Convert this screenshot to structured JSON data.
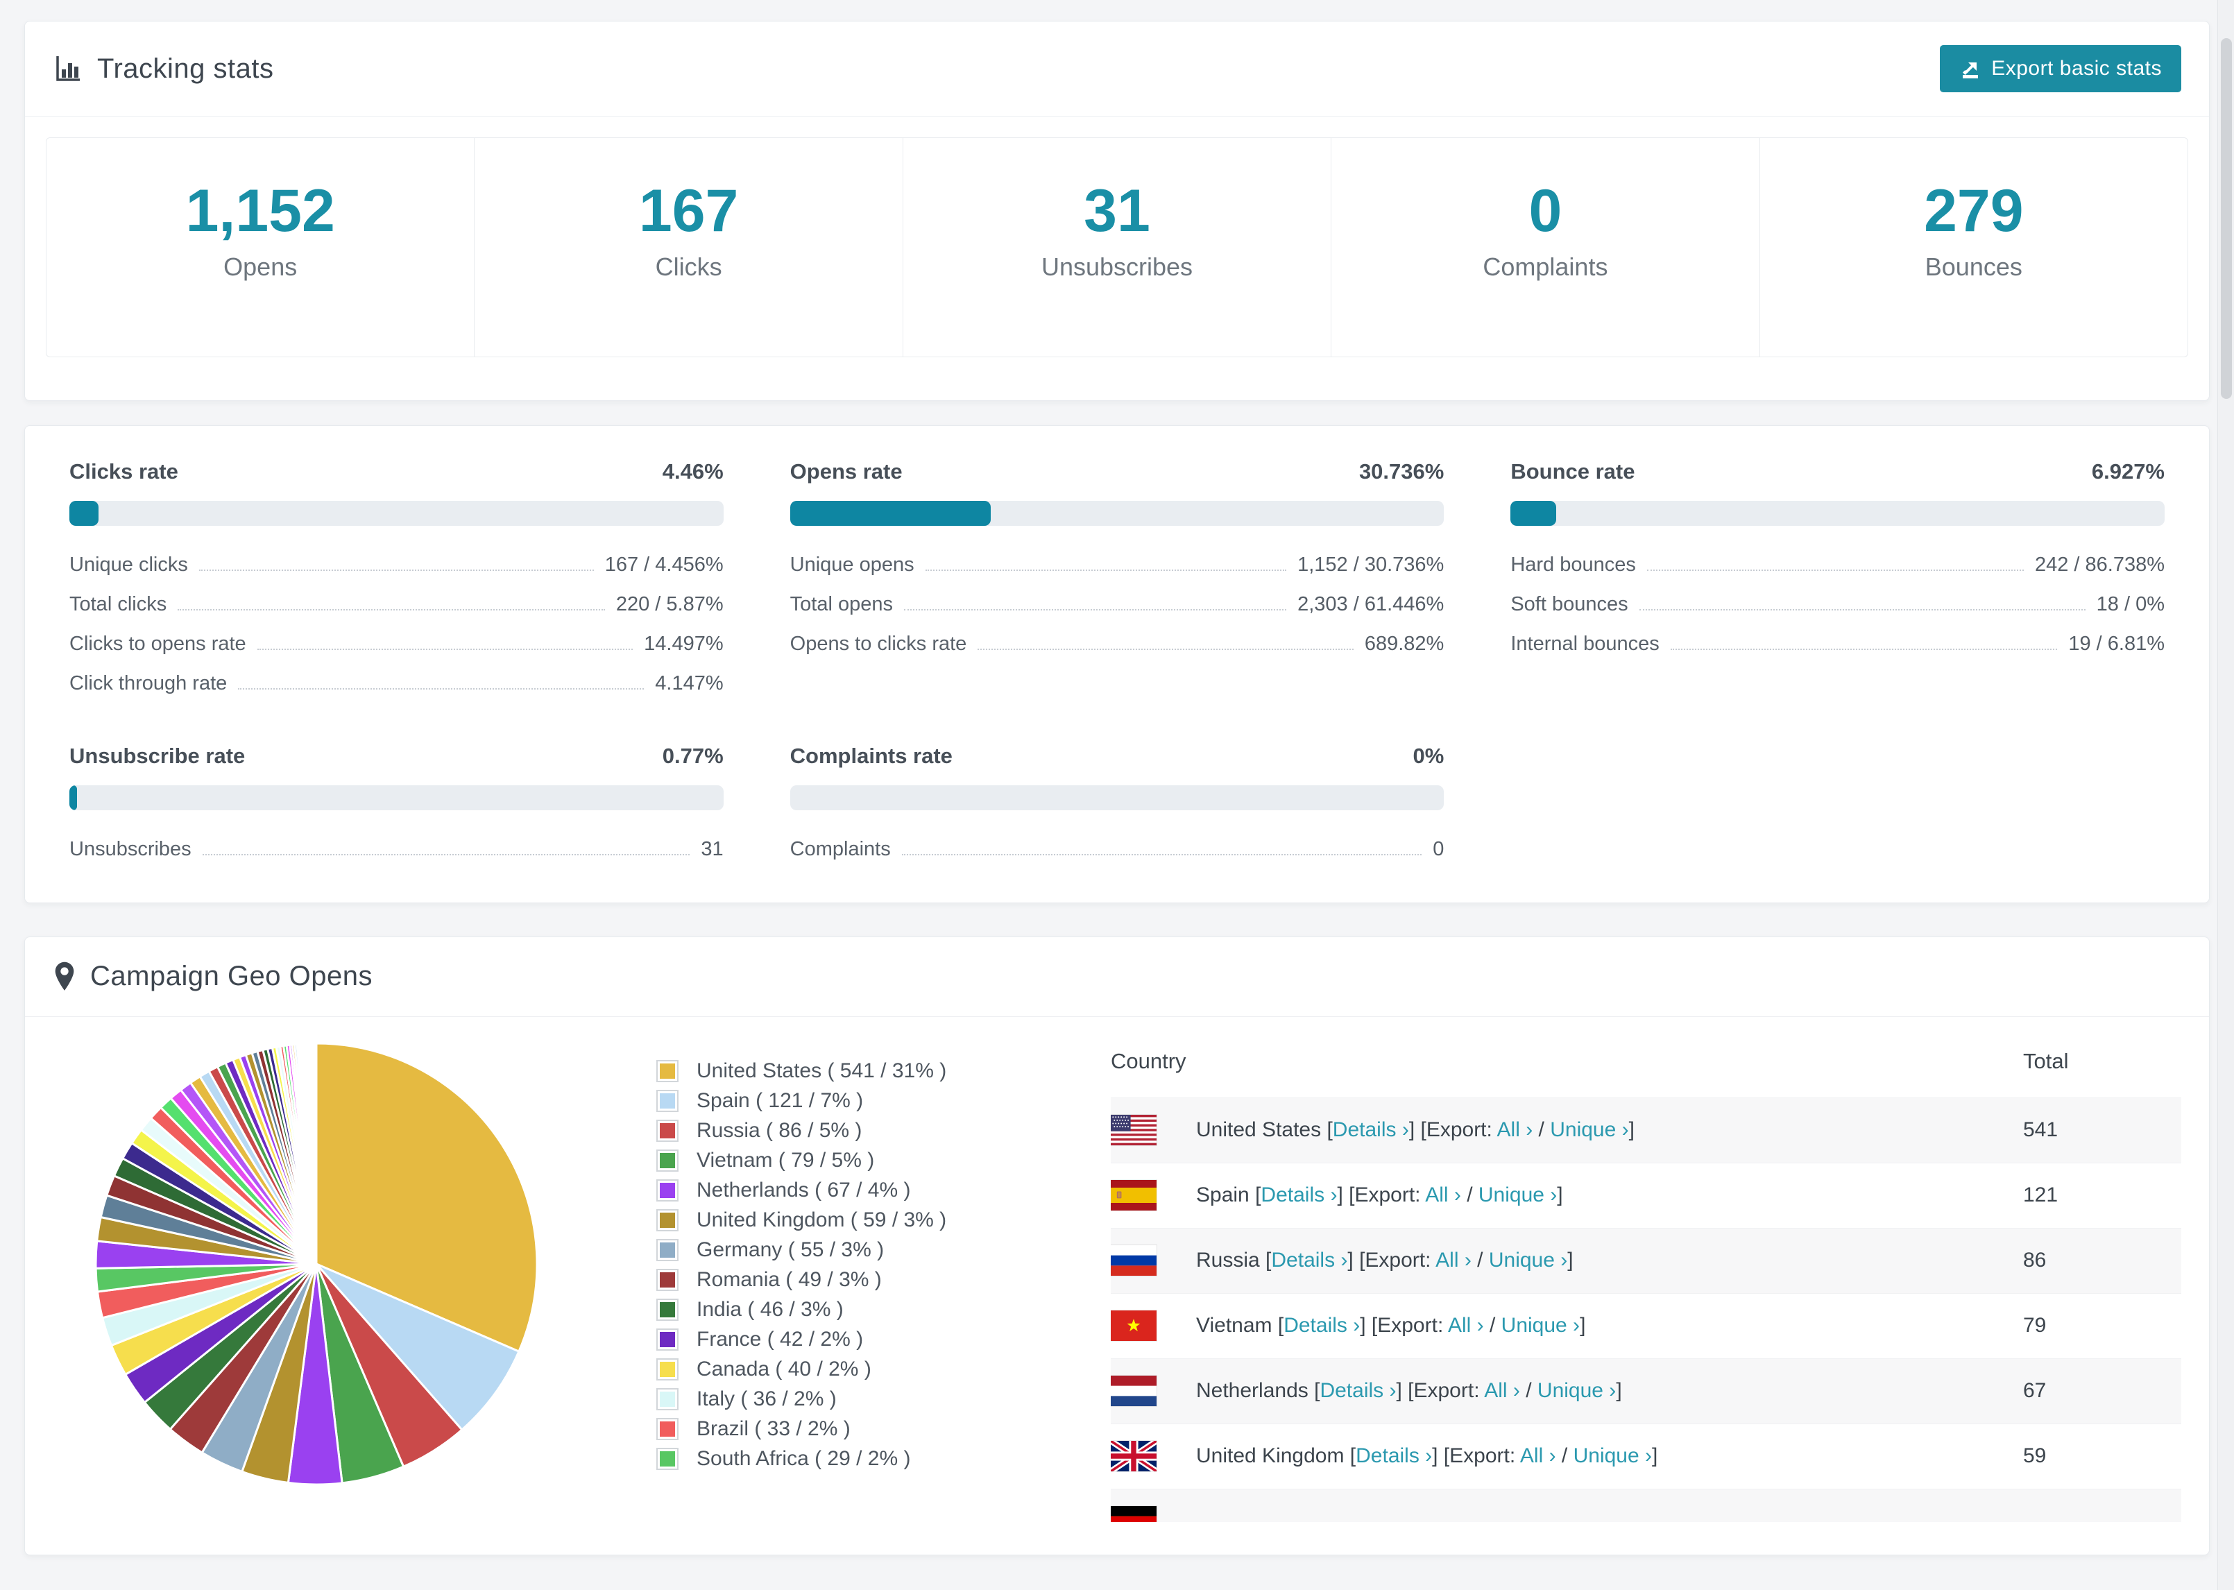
{
  "theme": {
    "accent_teal": "#1a8fa6",
    "button_teal": "#1b8ca2",
    "bar_fill_teal": "#0e86a2",
    "link_teal": "#2b99af",
    "bar_track": "#e9edf1",
    "page_bg": "#f4f5f7"
  },
  "tracking_card": {
    "title": "Tracking stats",
    "export_button": "Export basic stats",
    "stats": [
      {
        "value": "1,152",
        "label": "Opens"
      },
      {
        "value": "167",
        "label": "Clicks"
      },
      {
        "value": "31",
        "label": "Unsubscribes"
      },
      {
        "value": "0",
        "label": "Complaints"
      },
      {
        "value": "279",
        "label": "Bounces"
      }
    ]
  },
  "rate_blocks": [
    {
      "title": "Clicks rate",
      "value": "4.46%",
      "percent": 4.46,
      "rows": [
        [
          "Unique clicks",
          "167 / 4.456%"
        ],
        [
          "Total clicks",
          "220 / 5.87%"
        ],
        [
          "Clicks to opens rate",
          "14.497%"
        ],
        [
          "Click through rate",
          "4.147%"
        ]
      ]
    },
    {
      "title": "Opens rate",
      "value": "30.736%",
      "percent": 30.736,
      "rows": [
        [
          "Unique opens",
          "1,152 / 30.736%"
        ],
        [
          "Total opens",
          "2,303 / 61.446%"
        ],
        [
          "Opens to clicks rate",
          "689.82%"
        ]
      ]
    },
    {
      "title": "Bounce rate",
      "value": "6.927%",
      "percent": 6.927,
      "rows": [
        [
          "Hard bounces",
          "242 / 86.738%"
        ],
        [
          "Soft bounces",
          "18 / 0%"
        ],
        [
          "Internal bounces",
          "19 / 6.81%"
        ]
      ]
    },
    {
      "title": "Unsubscribe rate",
      "value": "0.77%",
      "percent": 0.77,
      "rows": [
        [
          "Unsubscribes",
          "31"
        ]
      ]
    },
    {
      "title": "Complaints rate",
      "value": "0%",
      "percent": 0,
      "rows": [
        [
          "Complaints",
          "0"
        ]
      ]
    }
  ],
  "geo_card": {
    "title": "Campaign Geo Opens",
    "table": {
      "headers": [
        "Country",
        "Total"
      ],
      "link_details": "Details",
      "export_prefix": "Export:",
      "link_all": "All",
      "link_unique": "Unique",
      "chevron": "›",
      "rows": [
        {
          "flag": "us",
          "country": "United States",
          "total": "541"
        },
        {
          "flag": "es",
          "country": "Spain",
          "total": "121"
        },
        {
          "flag": "ru",
          "country": "Russia",
          "total": "86"
        },
        {
          "flag": "vn",
          "country": "Vietnam",
          "total": "79"
        },
        {
          "flag": "nl",
          "country": "Netherlands",
          "total": "67"
        },
        {
          "flag": "gb",
          "country": "United Kingdom",
          "total": "59"
        },
        {
          "flag": "de",
          "country": "",
          "total": ""
        }
      ]
    }
  },
  "chart_data": {
    "type": "pie",
    "title": "Campaign Geo Opens",
    "legend_position": "right",
    "legend_format": "{label} ( {count} / {pct}% )",
    "slices": [
      {
        "label": "United States",
        "count": 541,
        "pct": 31,
        "color": "#e5ba41"
      },
      {
        "label": "Spain",
        "count": 121,
        "pct": 7,
        "color": "#b8d9f3"
      },
      {
        "label": "Russia",
        "count": 86,
        "pct": 5,
        "color": "#ca4a4a"
      },
      {
        "label": "Vietnam",
        "count": 79,
        "pct": 5,
        "color": "#4aa44e"
      },
      {
        "label": "Netherlands",
        "count": 67,
        "pct": 4,
        "color": "#9a41f0"
      },
      {
        "label": "United Kingdom",
        "count": 59,
        "pct": 3,
        "color": "#b3922f"
      },
      {
        "label": "Germany",
        "count": 55,
        "pct": 3,
        "color": "#8fadc6"
      },
      {
        "label": "Romania",
        "count": 49,
        "pct": 3,
        "color": "#9e3a3a"
      },
      {
        "label": "India",
        "count": 46,
        "pct": 3,
        "color": "#35793b"
      },
      {
        "label": "France",
        "count": 42,
        "pct": 2,
        "color": "#6e2ac2"
      },
      {
        "label": "Canada",
        "count": 40,
        "pct": 2,
        "color": "#f6de4d"
      },
      {
        "label": "Italy",
        "count": 36,
        "pct": 2,
        "color": "#d9f7f7"
      },
      {
        "label": "Brazil",
        "count": 33,
        "pct": 2,
        "color": "#f15d5d"
      },
      {
        "label": "South Africa",
        "count": 29,
        "pct": 2,
        "color": "#58c763"
      }
    ],
    "other_small_slices": [
      34,
      30,
      28,
      26,
      24,
      22,
      20,
      19,
      18,
      17,
      16,
      15,
      14,
      13,
      12,
      11,
      10,
      9,
      8,
      8,
      7,
      7,
      6,
      6,
      5,
      5,
      4,
      4,
      4,
      3,
      3,
      3,
      2,
      2,
      2,
      2,
      2,
      2,
      1,
      1,
      1,
      1,
      1,
      1,
      1,
      1,
      1,
      1,
      1,
      1
    ],
    "other_palette": [
      "#9a41f0",
      "#b3922f",
      "#5f7f98",
      "#8f3333",
      "#2e6b35",
      "#3c2a8e",
      "#f4f44a",
      "#e8fbfb",
      "#f15d5d",
      "#55e06e",
      "#e44cf0",
      "#b455f7",
      "#e5ba41",
      "#b8d9f3",
      "#ca4a4a",
      "#4aa44e",
      "#6e2ac2",
      "#f6de4d"
    ]
  }
}
